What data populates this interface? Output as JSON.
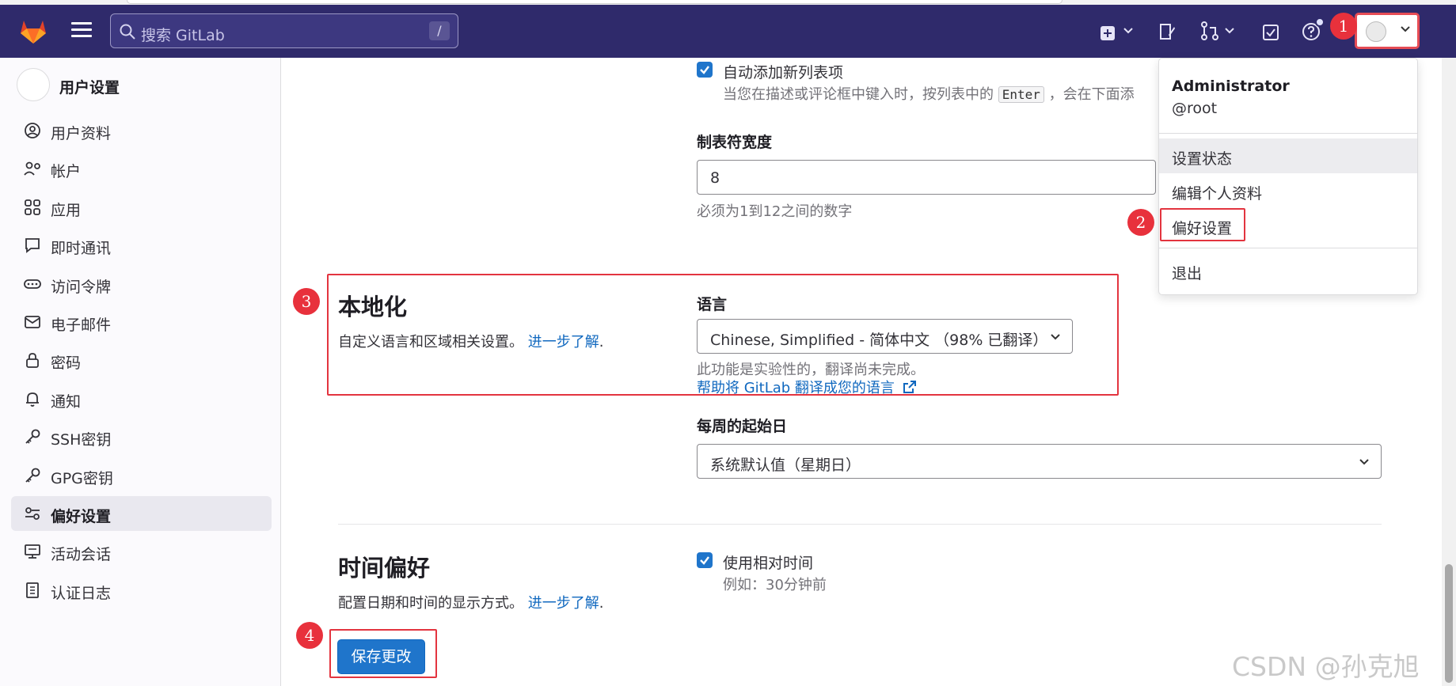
{
  "search": {
    "placeholder": "搜索 GitLab",
    "shortcut": "/"
  },
  "sidebar": {
    "title": "用户设置",
    "items": [
      {
        "label": "用户资料",
        "icon": "user-circle-icon"
      },
      {
        "label": "帐户",
        "icon": "account-gear-icon"
      },
      {
        "label": "应用",
        "icon": "apps-grid-icon"
      },
      {
        "label": "即时通讯",
        "icon": "chat-bubble-icon"
      },
      {
        "label": "访问令牌",
        "icon": "token-icon"
      },
      {
        "label": "电子邮件",
        "icon": "mail-icon"
      },
      {
        "label": "密码",
        "icon": "lock-icon"
      },
      {
        "label": "通知",
        "icon": "bell-icon"
      },
      {
        "label": "SSH密钥",
        "icon": "key-icon"
      },
      {
        "label": "GPG密钥",
        "icon": "key-icon"
      },
      {
        "label": "偏好设置",
        "icon": "preferences-icon",
        "active": true
      },
      {
        "label": "活动会话",
        "icon": "monitor-icon"
      },
      {
        "label": "认证日志",
        "icon": "log-icon"
      }
    ]
  },
  "behavior": {
    "auto_list_label": "自动添加新列表项",
    "auto_list_help_pre": "当您在描述或评论框中键入时，按列表中的",
    "auto_list_help_key": "Enter",
    "auto_list_help_post": "，会在下面添",
    "tab_width_label": "制表符宽度",
    "tab_width_value": "8",
    "tab_width_help": "必须为1到12之间的数字"
  },
  "localization": {
    "title": "本地化",
    "desc": "自定义语言和区域相关设置。",
    "learn_more": "进一步了解",
    "language_label": "语言",
    "language_value": "Chinese, Simplified - 简体中文 （98% 已翻译）",
    "experimental_note": "此功能是实验性的，翻译尚未完成。",
    "help_translate": "帮助将 GitLab 翻译成您的语言",
    "week_start_label": "每周的起始日",
    "week_start_value": "系统默认值（星期日）"
  },
  "time_prefs": {
    "title": "时间偏好",
    "desc": "配置日期和时间的显示方式。",
    "learn_more": "进一步了解",
    "relative_label": "使用相对时间",
    "relative_example": "例如：30分钟前"
  },
  "save_label": "保存更改",
  "user_menu": {
    "name": "Administrator",
    "username": "@root",
    "items": [
      "设置状态",
      "编辑个人资料",
      "偏好设置"
    ],
    "signout": "退出"
  },
  "annotations": [
    "1",
    "2",
    "3",
    "4"
  ],
  "watermark": "CSDN @孙克旭",
  "colors": {
    "header": "#2f2a6b",
    "primary": "#1f75cb",
    "annotation": "#e3343f"
  }
}
